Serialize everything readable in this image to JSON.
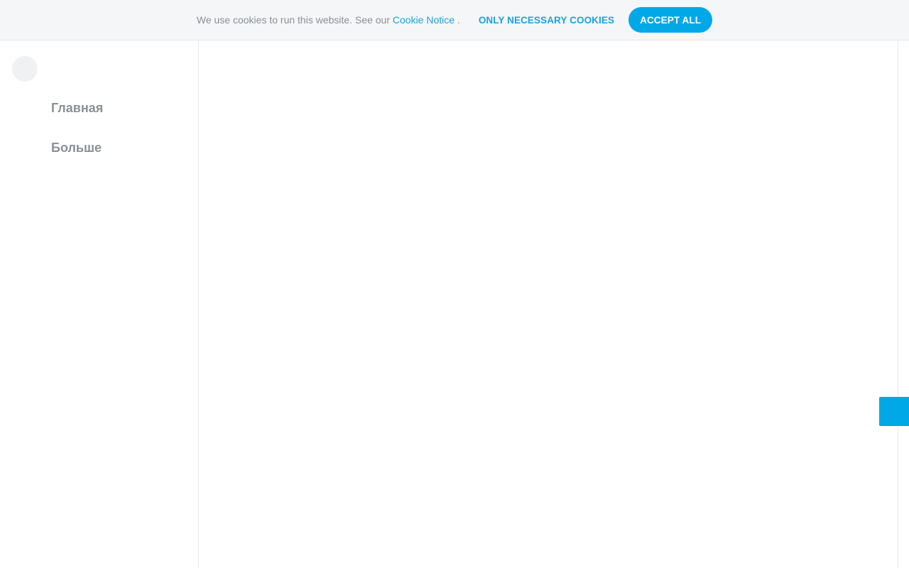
{
  "cookie_banner": {
    "message": "We use cookies to run this website. See our",
    "link_label": "Cookie Notice",
    "period": " .",
    "necessary_label": "ONLY NECESSARY COOKIES",
    "accept_label": "ACCEPT ALL"
  },
  "sidebar": {
    "items": [
      {
        "label": "Главная"
      },
      {
        "label": "Больше"
      }
    ]
  },
  "colors": {
    "accent": "#00a8e8",
    "link": "#1ba3dc",
    "nav_text": "#8a9099",
    "banner_bg": "#f5f6f7"
  }
}
